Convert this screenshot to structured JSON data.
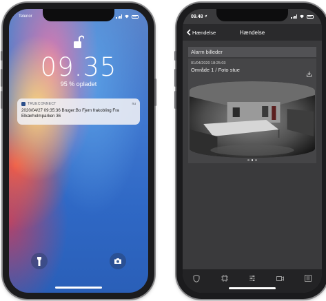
{
  "lock_screen": {
    "carrier": "Telenor",
    "time": "09.35",
    "battery_text": "95 % opladet",
    "notification": {
      "app_name": "TRUECONNECT",
      "time": "nu",
      "message": "2020/04/27 09:35:36 Bruger:Bo Fjern frakobling Fra Elkærholmparken 36"
    },
    "icons": {
      "lock": "unlocked-padlock-icon",
      "flashlight": "flashlight-icon",
      "camera": "camera-icon"
    }
  },
  "app_screen": {
    "status_time": "09.48",
    "nav": {
      "back_label": "Hændelse",
      "title": "Hændelse"
    },
    "section_header": "Alarm billeder",
    "photo_card": {
      "date": "01/04/2020 18:25:03",
      "title": "Område 1 / Foto stue"
    },
    "pager_dots": 3,
    "active_dot": 1,
    "tabs": [
      "shield-icon",
      "panel-icon",
      "sliders-icon",
      "video-camera-icon",
      "list-icon"
    ]
  },
  "colors": {
    "app_background": "#3a3a3c",
    "navbar": "#2a2a2c",
    "section_header": "#525255",
    "tabbar": "#232325",
    "lock_wallpaper": "#3f77cf"
  }
}
